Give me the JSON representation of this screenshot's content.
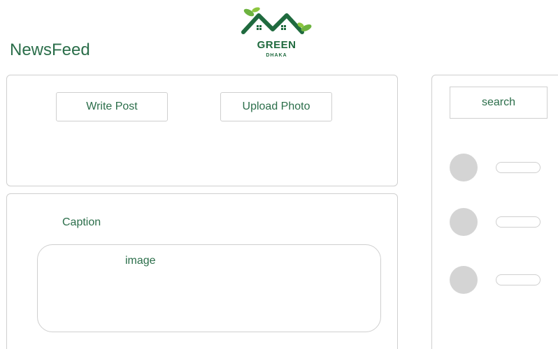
{
  "header": {
    "title": "NewsFeed",
    "logo": {
      "word": "GREEN",
      "sub": "DHAKA",
      "icon": "house-roof-leaves-icon",
      "colors": {
        "primary": "#1f6a3e",
        "leaf": "#6db33f"
      }
    }
  },
  "composer": {
    "write_post_label": "Write Post",
    "upload_photo_label": "Upload Photo"
  },
  "post": {
    "caption_label": "Caption",
    "image_label": "image"
  },
  "sidebar": {
    "search_label": "search",
    "users": [
      {
        "avatar": "avatar-placeholder",
        "name": ""
      },
      {
        "avatar": "avatar-placeholder",
        "name": ""
      },
      {
        "avatar": "avatar-placeholder",
        "name": ""
      }
    ]
  },
  "theme": {
    "text_color": "#2b6e4a",
    "border_color": "#cfcfcf",
    "avatar_color": "#d4d4d4"
  }
}
